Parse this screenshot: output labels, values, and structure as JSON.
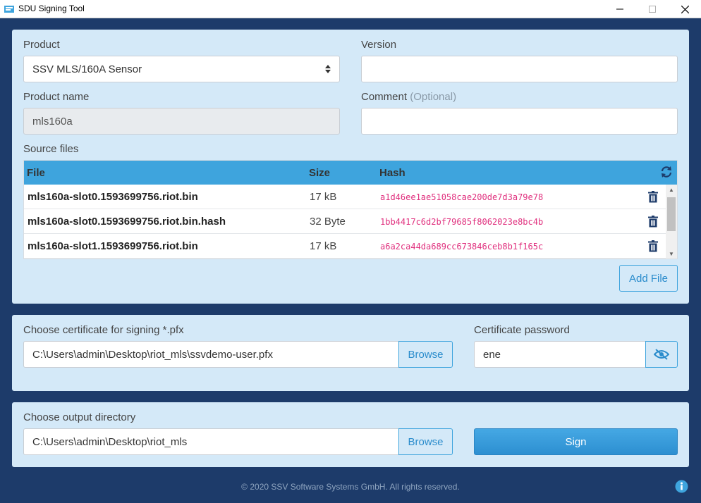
{
  "window": {
    "title": "SDU Signing Tool"
  },
  "product_section": {
    "product_label": "Product",
    "product_value": "SSV MLS/160A Sensor",
    "version_label": "Version",
    "version_value": "",
    "product_name_label": "Product name",
    "product_name_value": "mls160a",
    "comment_label": "Comment",
    "comment_optional": "(Optional)",
    "comment_value": "",
    "source_files_label": "Source files",
    "table": {
      "headers": [
        "File",
        "Size",
        "Hash"
      ],
      "rows": [
        {
          "file": "mls160a-slot0.1593699756.riot.bin",
          "size": "17 kB",
          "hash": "a1d46ee1ae51058cae200de7d3a79e78"
        },
        {
          "file": "mls160a-slot0.1593699756.riot.bin.hash",
          "size": "32 Byte",
          "hash": "1bb4417c6d2bf79685f8062023e8bc4b"
        },
        {
          "file": "mls160a-slot1.1593699756.riot.bin",
          "size": "17 kB",
          "hash": "a6a2ca44da689cc673846ceb8b1f165c"
        }
      ]
    },
    "add_file_label": "Add File"
  },
  "certificate_section": {
    "cert_label": "Choose certificate for signing *.pfx",
    "cert_path": "C:\\Users\\admin\\Desktop\\riot_mls\\ssvdemo-user.pfx",
    "browse_label": "Browse",
    "password_label": "Certificate password",
    "password_value": "ene"
  },
  "output_section": {
    "output_label": "Choose output directory",
    "output_path": "C:\\Users\\admin\\Desktop\\riot_mls",
    "browse_label": "Browse",
    "sign_label": "Sign"
  },
  "footer": {
    "copyright": "© 2020 SSV Software Systems GmbH. All rights reserved."
  },
  "colors": {
    "background": "#1d3b6a",
    "panel": "#d4e9f8",
    "accent": "#3ea4dd",
    "hash_text": "#e0307e",
    "delete_icon": "#1d3b6a"
  },
  "icons": {
    "app": "app-icon",
    "refresh": "refresh-icon",
    "delete": "trash-icon",
    "visibility": "eye-slash-icon",
    "info": "info-icon",
    "select_caret": "updown-caret-icon"
  }
}
